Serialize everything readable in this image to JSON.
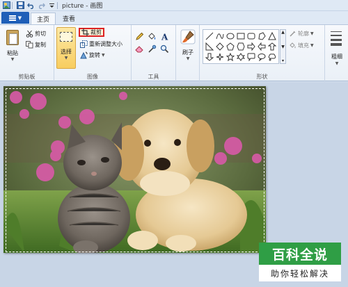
{
  "window": {
    "title": "picture - 画图"
  },
  "tabs": {
    "home": "主页",
    "view": "查看"
  },
  "clipboard": {
    "paste": "粘贴",
    "cut": "剪切",
    "copy": "复制",
    "group_label": "剪贴板"
  },
  "image": {
    "select": "选择",
    "crop": "裁剪",
    "resize": "重新调整大小",
    "rotate": "旋转",
    "group_label": "图像"
  },
  "tools": {
    "group_label": "工具"
  },
  "brushes": {
    "label": "刷子"
  },
  "shapes": {
    "outline": "轮廓",
    "fill": "填充",
    "group_label": "形状"
  },
  "thickness": {
    "label": "粗细"
  },
  "watermark": {
    "line1": "百科全说",
    "line2": "助你轻松解决"
  },
  "colors": {
    "accent": "#1f5fb8",
    "select_highlight": "#f8cd5f",
    "crop_border": "#dd2222",
    "watermark_green": "#2f9e45"
  }
}
